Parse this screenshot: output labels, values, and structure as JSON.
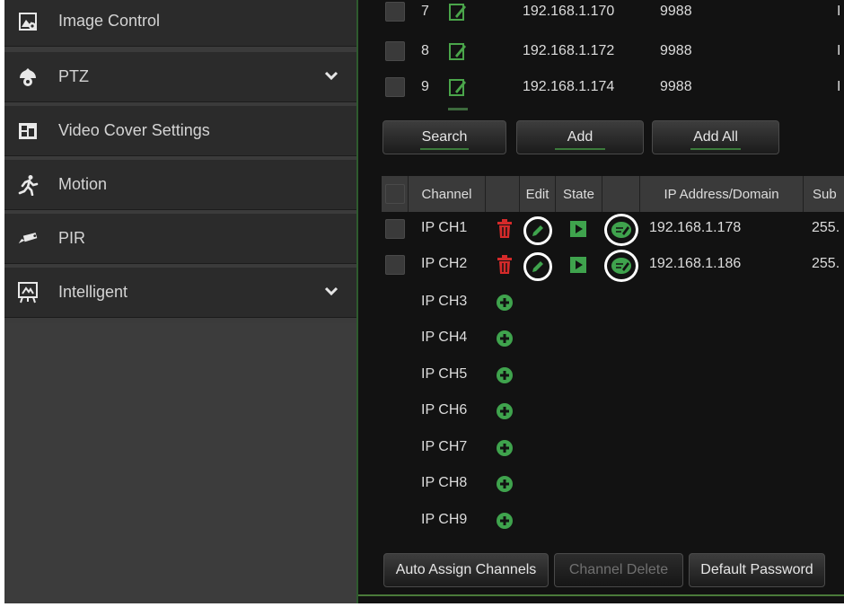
{
  "sidebar": {
    "items": [
      {
        "label": "Image Control",
        "icon": "image-control-icon",
        "expandable": false
      },
      {
        "label": "PTZ",
        "icon": "ptz-camera-icon",
        "expandable": true
      },
      {
        "label": "Video Cover Settings",
        "icon": "video-cover-icon",
        "expandable": false
      },
      {
        "label": "Motion",
        "icon": "running-man-icon",
        "expandable": false
      },
      {
        "label": "PIR",
        "icon": "pir-sensor-icon",
        "expandable": false
      },
      {
        "label": "Intelligent",
        "icon": "intelligent-icon",
        "expandable": true
      }
    ]
  },
  "device_list": [
    {
      "no": "7",
      "ip": "192.168.1.170",
      "port": "9988",
      "extra": "I"
    },
    {
      "no": "8",
      "ip": "192.168.1.172",
      "port": "9988",
      "extra": "I"
    },
    {
      "no": "9",
      "ip": "192.168.1.174",
      "port": "9988",
      "extra": "I"
    }
  ],
  "search_buttons": {
    "search": "Search",
    "add": "Add",
    "add_all": "Add All"
  },
  "channel_table": {
    "headers": {
      "channel": "Channel",
      "edit": "Edit",
      "state": "State",
      "ip": "IP Address/Domain",
      "subnet": "Sub"
    },
    "assigned": [
      {
        "channel": "IP CH1",
        "ip": "192.168.1.178",
        "subnet": "255."
      },
      {
        "channel": "IP CH2",
        "ip": "192.168.1.186",
        "subnet": "255."
      }
    ],
    "empty": [
      "IP CH3",
      "IP CH4",
      "IP CH5",
      "IP CH6",
      "IP CH7",
      "IP CH8",
      "IP CH9"
    ]
  },
  "bottom_buttons": {
    "auto_assign": "Auto Assign Channels",
    "channel_delete": "Channel Delete",
    "default_password": "Default Password"
  },
  "colors": {
    "accent_green": "#3fa34d",
    "delete_red": "#d42a2a",
    "panel_bg": "#121212",
    "sidebar_item_bg": "#2b2b2b"
  }
}
